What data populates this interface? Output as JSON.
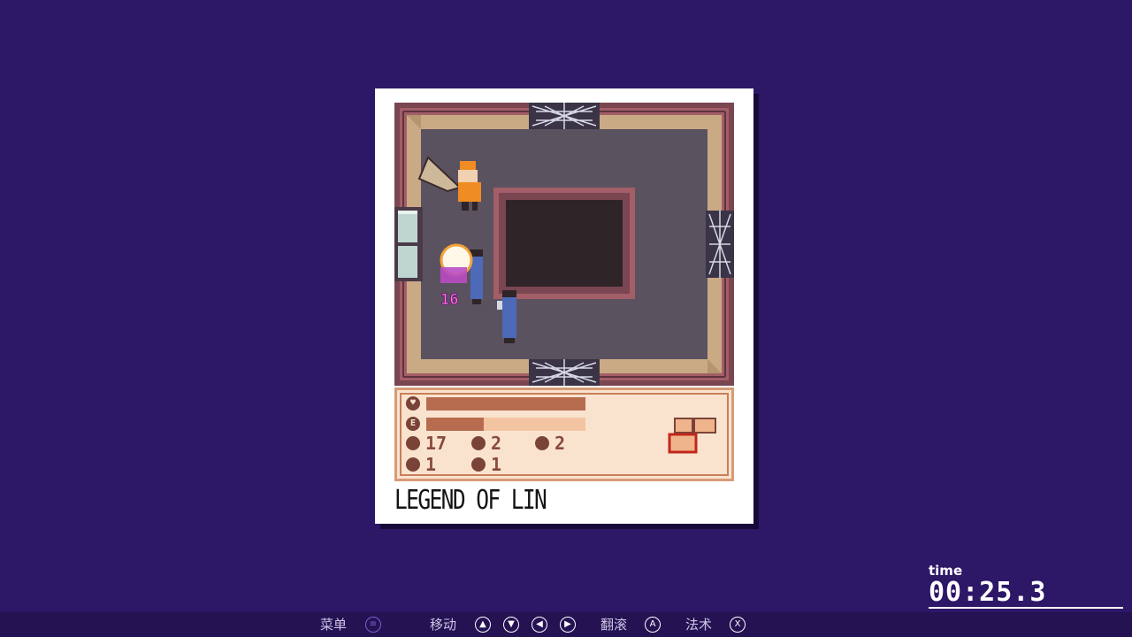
{
  "game": {
    "title": "LEGEND OF LIN",
    "damage_number": "16"
  },
  "hud": {
    "health_fraction": 1.0,
    "energy_fraction": 0.36,
    "stats": [
      {
        "icon": "sword-icon",
        "value": "17"
      },
      {
        "icon": "l-icon",
        "value": "2"
      },
      {
        "icon": "a-icon",
        "value": "2"
      },
      {
        "icon": "bomb-icon",
        "value": "1"
      },
      {
        "icon": "d-icon",
        "value": "1"
      }
    ]
  },
  "timer": {
    "label": "time",
    "value": "00:25.3"
  },
  "controls": {
    "menu": "菜单",
    "move": "移动",
    "flip": "翻滚",
    "spell": "法术",
    "menu_btn": "≡",
    "a_btn": "A",
    "x_btn": "X"
  },
  "colors": {
    "background": "#2d1767",
    "floor": "#5b5260",
    "wall": "#c9aa84",
    "pit": "#2f2428",
    "hud_bg": "#f9e3cf",
    "bar_fill": "#b76c4f"
  }
}
